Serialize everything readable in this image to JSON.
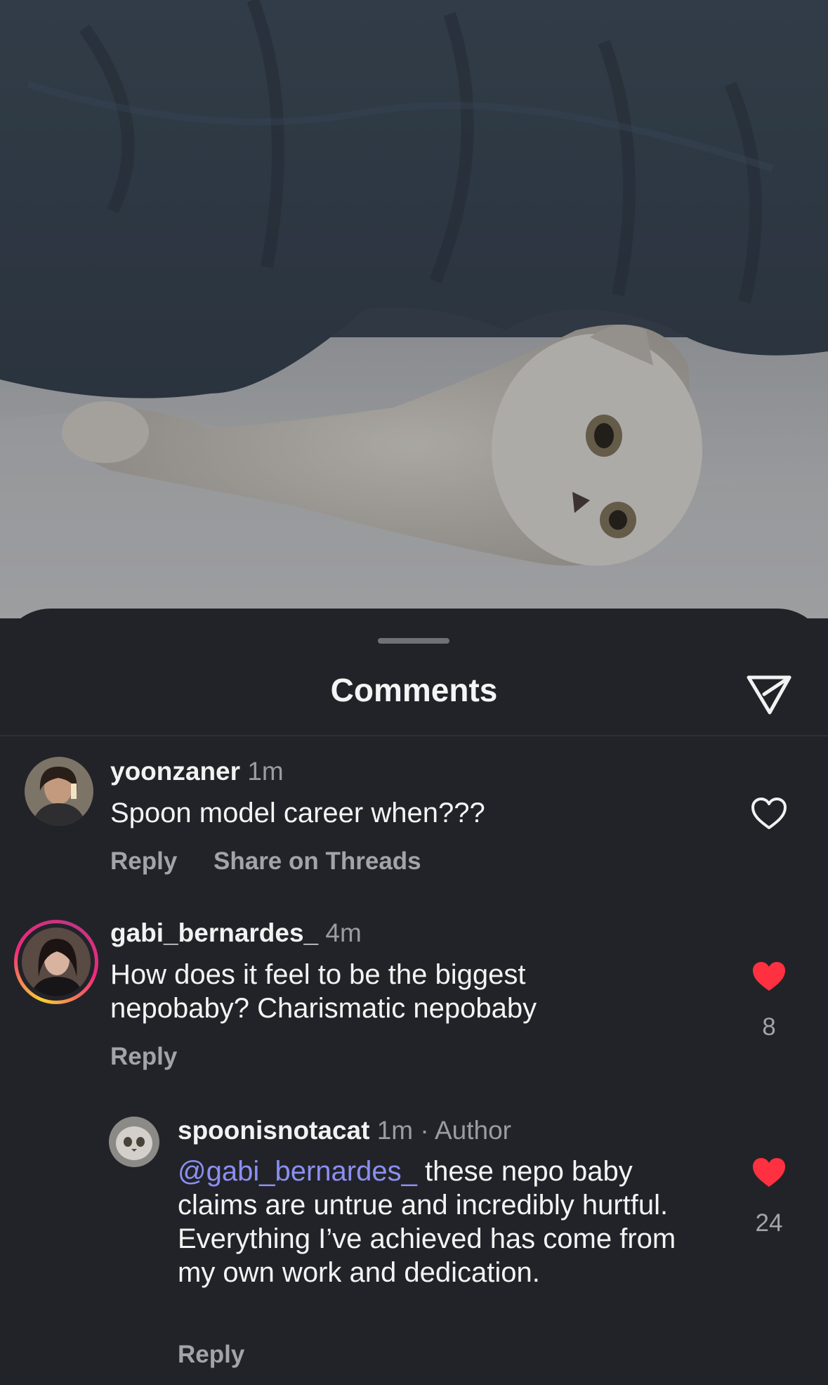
{
  "sheet": {
    "title": "Comments"
  },
  "comments": [
    {
      "username": "yoonzaner",
      "time": "1m",
      "text": "Spoon model career when???",
      "actions": [
        "Reply",
        "Share on Threads"
      ],
      "liked": false,
      "like_count": ""
    },
    {
      "username": "gabi_bernardes_",
      "time": "4m",
      "text": "How does it feel to be the biggest nepobaby? Charismatic nepobaby",
      "actions": [
        "Reply"
      ],
      "liked": true,
      "like_count": "8",
      "has_story_ring": true
    },
    {
      "username": "spoonisnotacat",
      "time": "1m",
      "author_tag": "· Author",
      "mention": "@gabi_bernardes_",
      "text": " these nepo baby claims are untrue and incredibly hurtful. Everything I’ve achieved has come from my own work and dedication.",
      "actions": [
        "Reply"
      ],
      "liked": true,
      "like_count": "24",
      "is_reply": true
    }
  ],
  "colors": {
    "background": "#222328",
    "like_active": "#ff3040",
    "mention": "#8b8ff2",
    "secondary_text": "#9a9ca2"
  },
  "icons": [
    "send-icon",
    "heart-outline-icon",
    "heart-filled-icon"
  ]
}
